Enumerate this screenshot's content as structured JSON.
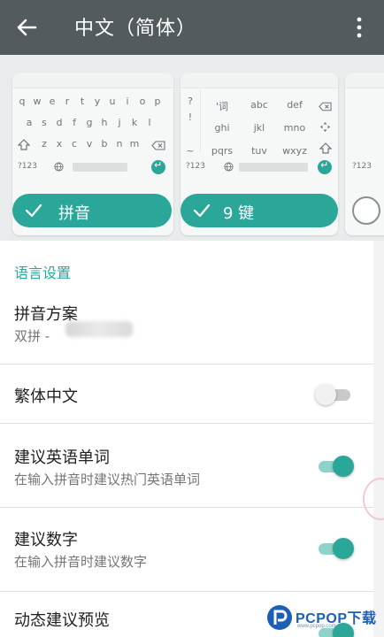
{
  "appbar": {
    "title": "中文（简体）",
    "back_icon": "arrow-left-icon",
    "more_icon": "more-vert-icon"
  },
  "layouts": {
    "qwerty": {
      "row1": [
        "q",
        "w",
        "e",
        "r",
        "t",
        "y",
        "u",
        "i",
        "o",
        "p"
      ],
      "row2": [
        "a",
        "s",
        "d",
        "f",
        "g",
        "h",
        "j",
        "k",
        "l"
      ],
      "row3": [
        "z",
        "x",
        "c",
        "v",
        "b",
        "n",
        "m"
      ],
      "bottom_left": "?123",
      "globe_icon": "globe-icon"
    },
    "nine_key": {
      "side": [
        "?",
        "!",
        "~"
      ],
      "grid": [
        "'词",
        "abc",
        "def",
        "ghi",
        "jkl",
        "mno",
        "pqrs",
        "tuv",
        "wxyz"
      ],
      "bottom_left": "?123"
    },
    "partial_bottom_left": "?123",
    "pinyin_label": "拼音",
    "nine_key_label": "9 键"
  },
  "section": {
    "language_settings": "语言设置"
  },
  "settings": [
    {
      "title": "拼音方案",
      "subtitle": "双拼 - "
    },
    {
      "title": "繁体中文",
      "toggle": "off"
    },
    {
      "title": "建议英语单词",
      "subtitle": "在输入拼音时建议热门英语单词",
      "toggle": "on"
    },
    {
      "title": "建议数字",
      "subtitle": "在输入拼音时建议数字",
      "toggle": "on"
    },
    {
      "title": "动态建议预览",
      "toggle": "on"
    }
  ],
  "watermark": {
    "brand": "PCPOP下载",
    "tag": "www.pcpop.com"
  },
  "colors": {
    "accent": "#2ba79a",
    "appbar": "#535b5e",
    "track_on": "#8ed3cb"
  }
}
